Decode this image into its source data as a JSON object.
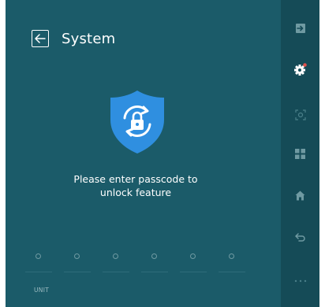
{
  "header": {
    "title": "System"
  },
  "message": {
    "line1": "Please enter passcode to",
    "line2": "unlock feature"
  },
  "passcode": {
    "digit_count": 6
  },
  "unit_label": "UNIT",
  "sidebar": {
    "items": [
      {
        "icon": "exit-icon",
        "active": false
      },
      {
        "icon": "gear-icon",
        "active": true
      },
      {
        "icon": "target-icon",
        "active": false
      },
      {
        "icon": "grid-icon",
        "active": false
      },
      {
        "icon": "home-icon",
        "active": false
      },
      {
        "icon": "back-arrow-icon",
        "active": false
      },
      {
        "icon": "more-icon",
        "active": false
      }
    ]
  },
  "colors": {
    "background": "#1b5b69",
    "sidebar": "#154b57",
    "shield": "#2f8fe0",
    "notification_dot": "#e0524c"
  }
}
